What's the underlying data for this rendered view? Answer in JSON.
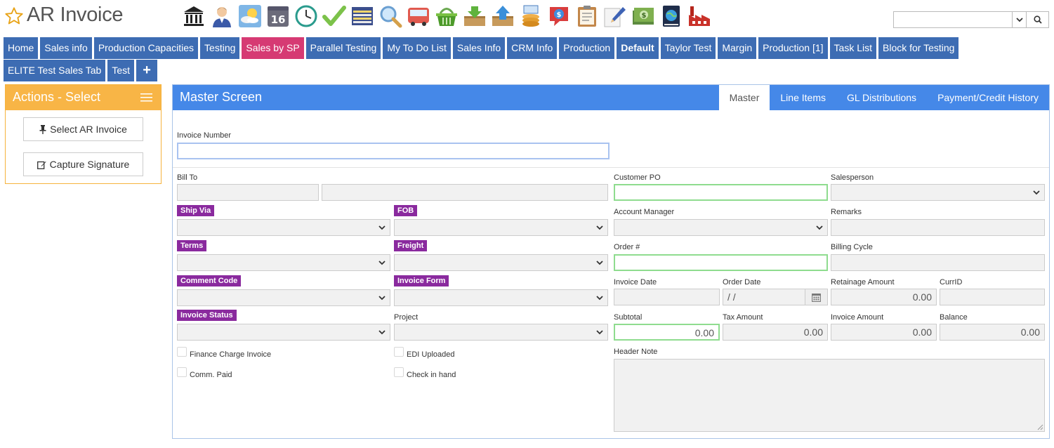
{
  "app": {
    "title": "AR Invoice"
  },
  "toolbar_icons": [
    "bank-icon",
    "user-icon",
    "weather-icon",
    "calendar-icon",
    "clock-icon",
    "checkmark-icon",
    "spreadsheet-icon",
    "magnifier-icon",
    "truck-icon",
    "basket-icon",
    "inbox-download-icon",
    "outbox-upload-icon",
    "money-stack-icon",
    "price-tag-icon",
    "clipboard-icon",
    "pencil-icon",
    "cash-icon",
    "globe-book-icon",
    "factory-icon"
  ],
  "calendar_day": "16",
  "search": {
    "placeholder": ""
  },
  "tabs": [
    {
      "label": "Home"
    },
    {
      "label": "Sales info"
    },
    {
      "label": "Production Capacities"
    },
    {
      "label": "Testing"
    },
    {
      "label": "Sales by SP"
    },
    {
      "label": "Parallel Testing"
    },
    {
      "label": "My To Do List"
    },
    {
      "label": "Sales Info"
    },
    {
      "label": "CRM Info"
    },
    {
      "label": "Production"
    },
    {
      "label": "Default"
    },
    {
      "label": "Taylor Test"
    },
    {
      "label": "Margin"
    },
    {
      "label": "Production [1]"
    },
    {
      "label": "Task List"
    },
    {
      "label": "Block for Testing"
    },
    {
      "label": "ELITE Test Sales Tab"
    },
    {
      "label": "Test"
    },
    {
      "label": "+"
    }
  ],
  "actions": {
    "title": "Actions - Select",
    "buttons": [
      {
        "label": "Select AR Invoice"
      },
      {
        "label": "Capture Signature"
      }
    ]
  },
  "master": {
    "title": "Master Screen",
    "tabs": [
      {
        "label": "Master"
      },
      {
        "label": "Line Items"
      },
      {
        "label": "GL Distributions"
      },
      {
        "label": "Payment/Credit History"
      }
    ]
  },
  "form": {
    "invoice_number": {
      "label": "Invoice Number",
      "value": ""
    },
    "bill_to": {
      "label": "Bill To"
    },
    "ship_via": {
      "label": "Ship Via"
    },
    "fob": {
      "label": "FOB"
    },
    "terms": {
      "label": "Terms"
    },
    "freight": {
      "label": "Freight"
    },
    "comment_code": {
      "label": "Comment Code"
    },
    "invoice_form": {
      "label": "Invoice Form"
    },
    "invoice_status": {
      "label": "Invoice Status"
    },
    "project": {
      "label": "Project"
    },
    "finance_charge_invoice": {
      "label": "Finance Charge Invoice"
    },
    "edi_uploaded": {
      "label": "EDI Uploaded"
    },
    "comm_paid": {
      "label": "Comm. Paid"
    },
    "check_in_hand": {
      "label": "Check in hand"
    },
    "customer_po": {
      "label": "Customer PO"
    },
    "salesperson": {
      "label": "Salesperson"
    },
    "account_manager": {
      "label": "Account Manager"
    },
    "remarks": {
      "label": "Remarks"
    },
    "order_no": {
      "label": "Order #"
    },
    "billing_cycle": {
      "label": "Billing Cycle"
    },
    "invoice_date": {
      "label": "Invoice Date"
    },
    "order_date": {
      "label": "Order Date",
      "value": " /  /"
    },
    "retainage_amount": {
      "label": "Retainage Amount",
      "value": "0.00"
    },
    "curr_id": {
      "label": "CurrID"
    },
    "subtotal": {
      "label": "Subtotal",
      "value": "0.00"
    },
    "tax_amount": {
      "label": "Tax Amount",
      "value": "0.00"
    },
    "invoice_amount": {
      "label": "Invoice Amount",
      "value": "0.00"
    },
    "balance": {
      "label": "Balance",
      "value": "0.00"
    },
    "header_note": {
      "label": "Header Note"
    }
  },
  "colors": {
    "tab_blue": "#3d6cb3",
    "tab_active_pink": "#d63a73",
    "actions_orange": "#f8b546",
    "master_header_blue": "#4588e8",
    "required_label_purple": "#8a2a9e",
    "required_field_green": "#8fdc8f"
  }
}
